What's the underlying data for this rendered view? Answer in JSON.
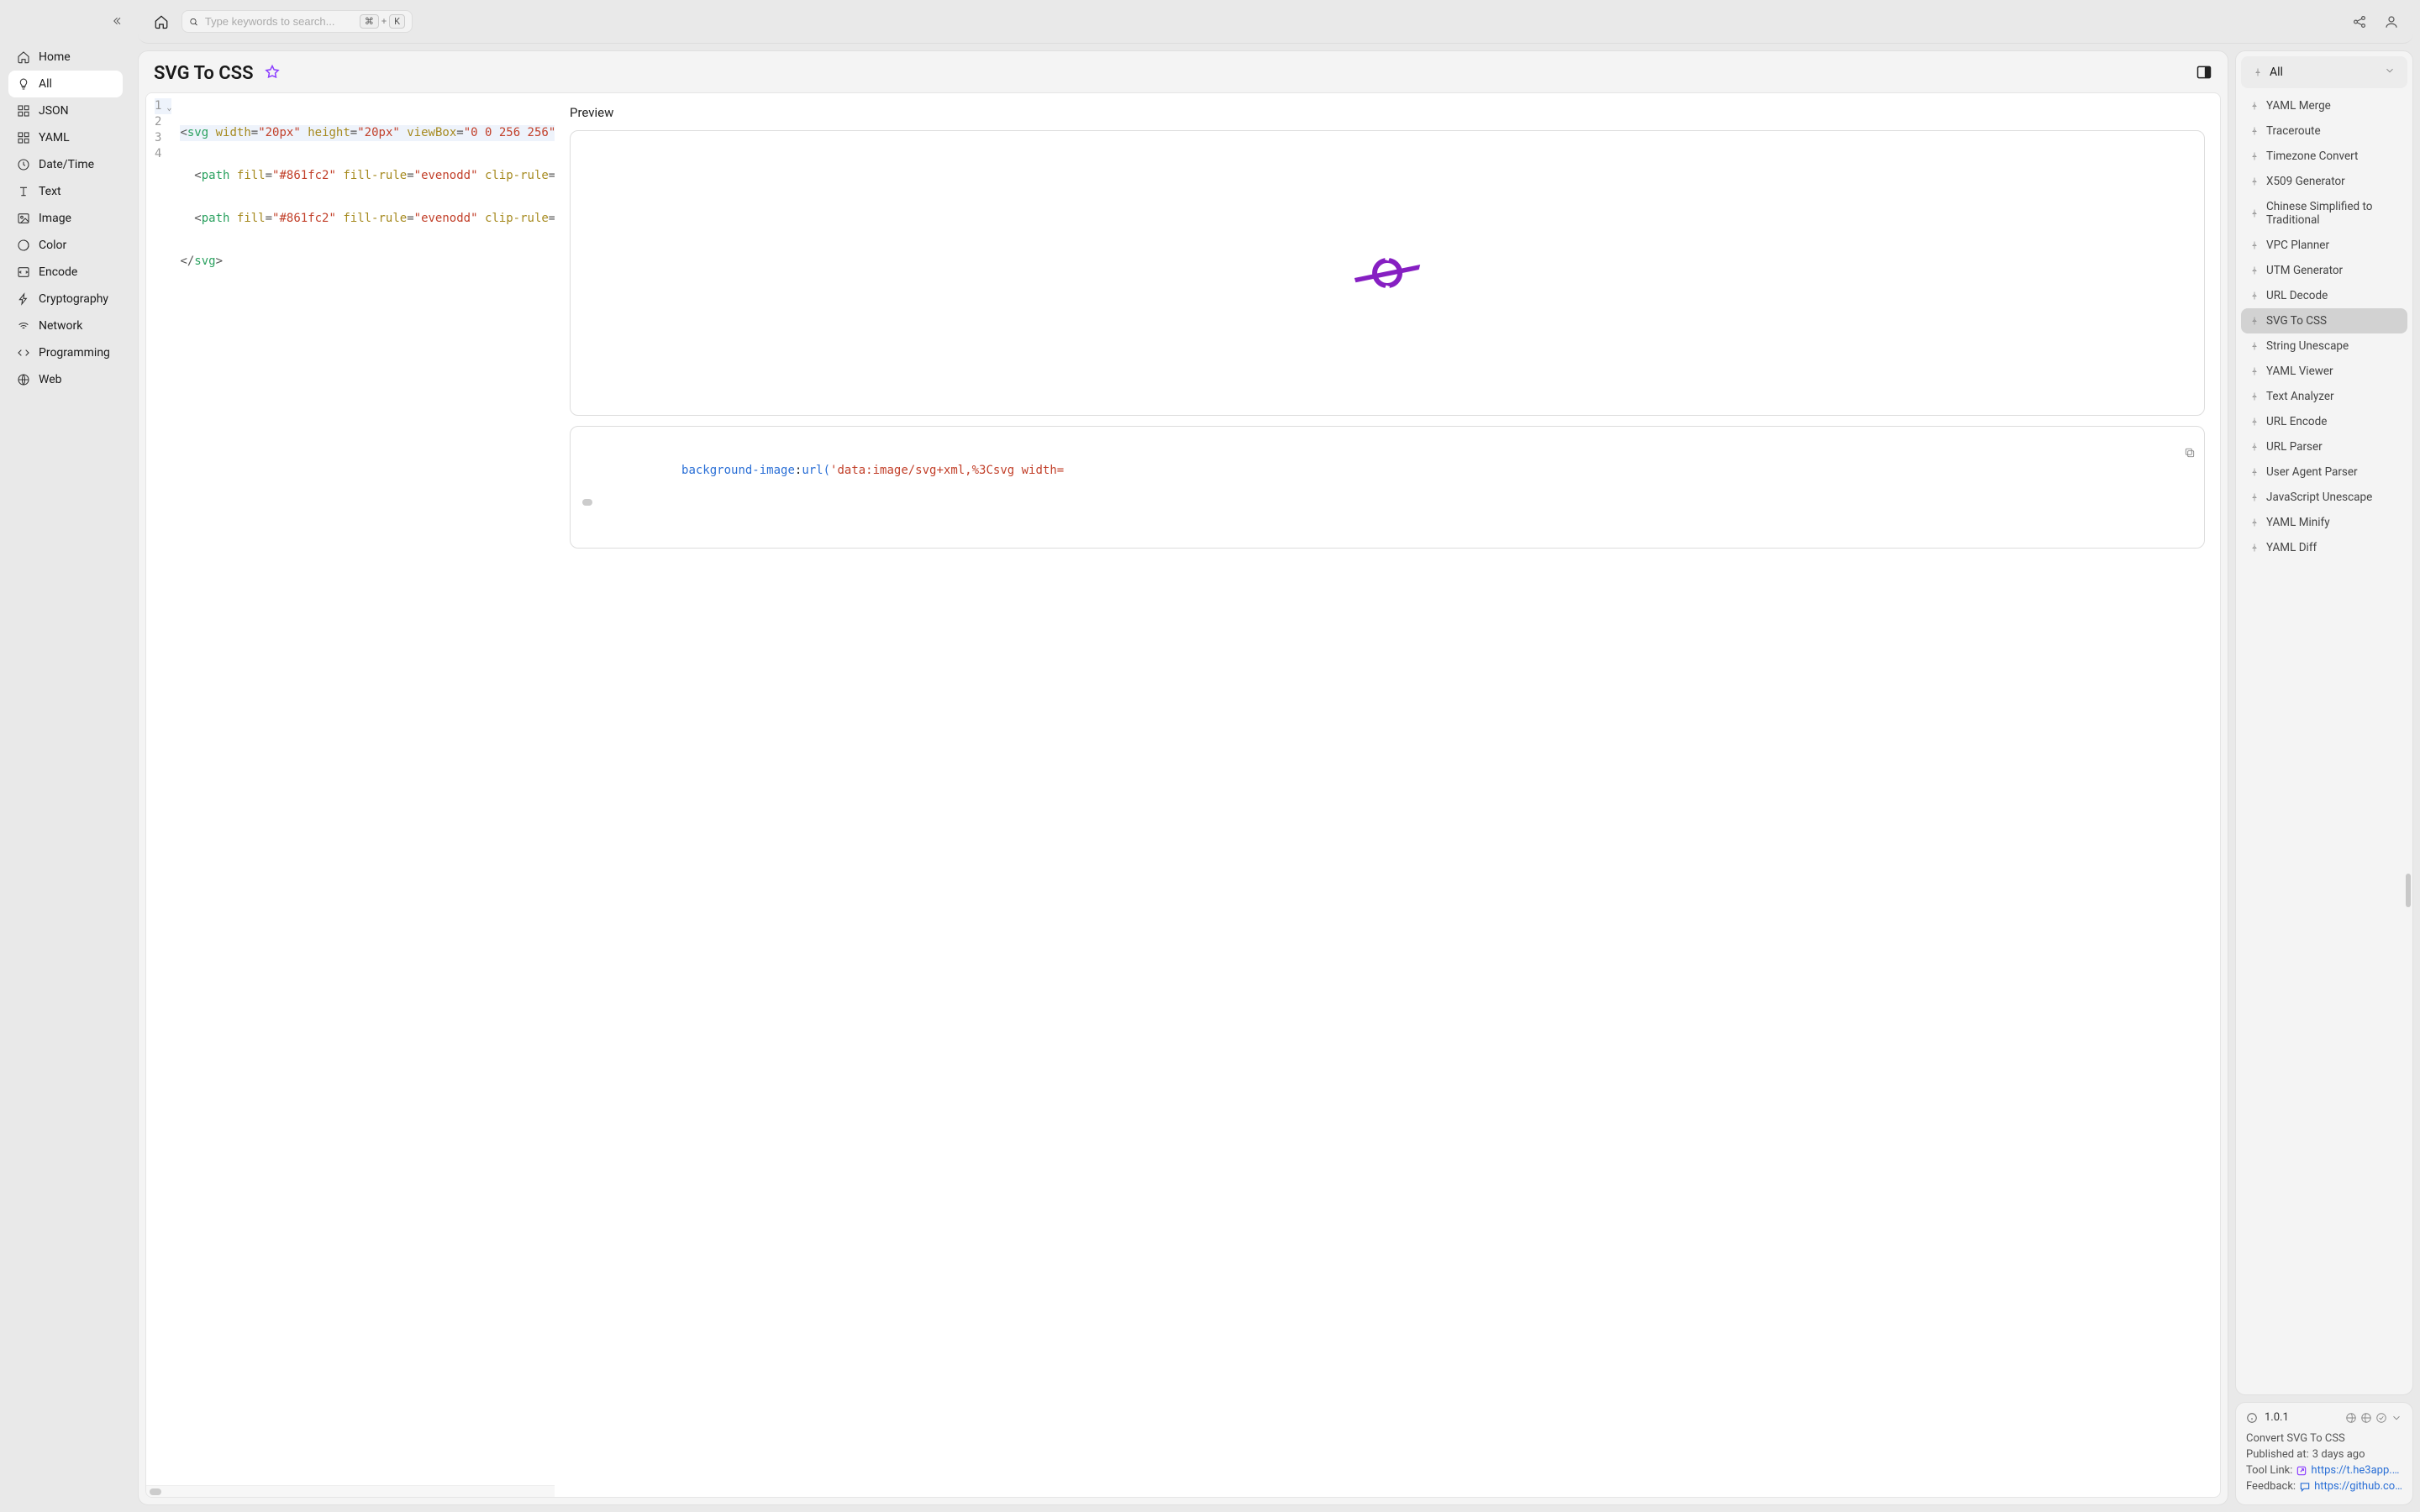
{
  "sidebar": {
    "items": [
      {
        "label": "Home",
        "icon": "home"
      },
      {
        "label": "All",
        "icon": "all",
        "active": true
      },
      {
        "label": "JSON",
        "icon": "json"
      },
      {
        "label": "YAML",
        "icon": "yaml"
      },
      {
        "label": "Date/Time",
        "icon": "clock"
      },
      {
        "label": "Text",
        "icon": "text"
      },
      {
        "label": "Image",
        "icon": "image"
      },
      {
        "label": "Color",
        "icon": "color"
      },
      {
        "label": "Encode",
        "icon": "encode"
      },
      {
        "label": "Cryptography",
        "icon": "crypto"
      },
      {
        "label": "Network",
        "icon": "network"
      },
      {
        "label": "Programming",
        "icon": "programming"
      },
      {
        "label": "Web",
        "icon": "web"
      }
    ]
  },
  "search": {
    "placeholder": "Type keywords to search...",
    "kbd1": "⌘",
    "kbd_plus": "+",
    "kbd2": "K"
  },
  "page": {
    "title": "SVG To CSS"
  },
  "editor": {
    "lines": {
      "l1": {
        "n": "1",
        "open": "<",
        "tag": "svg",
        "a1": "width",
        "v1": "\"20px\"",
        "a2": "height",
        "v2": "\"20px\"",
        "a3": "viewBox",
        "v3": "\"0 0 256 256\"",
        "tail": " "
      },
      "l2": {
        "n": "2",
        "open": "<",
        "tag": "path",
        "a1": "fill",
        "v1": "\"#861fc2\"",
        "a2": "fill-rule",
        "v2": "\"evenodd\"",
        "a3": "clip-rule",
        "v3": "\""
      },
      "l3": {
        "n": "3",
        "open": "<",
        "tag": "path",
        "a1": "fill",
        "v1": "\"#861fc2\"",
        "a2": "fill-rule",
        "v2": "\"evenodd\"",
        "a3": "clip-rule",
        "v3": "\""
      },
      "l4": {
        "n": "4",
        "open": "</",
        "tag": "svg",
        "close": ">"
      }
    }
  },
  "preview": {
    "label": "Preview"
  },
  "output": {
    "prop": "background-image",
    "colon": ":",
    "func": "url(",
    "q": "'",
    "val": "data:image/svg+xml,%3Csvg width="
  },
  "tools": {
    "filter_label": "All",
    "items": [
      "YAML Merge",
      "Traceroute",
      "Timezone Convert",
      "X509 Generator",
      "Chinese Simplified to Traditional",
      "VPC Planner",
      "UTM Generator",
      "URL Decode",
      "SVG To CSS",
      "String Unescape",
      "YAML Viewer",
      "Text Analyzer",
      "URL Encode",
      "URL Parser",
      "User Agent Parser",
      "JavaScript Unescape",
      "YAML Minify",
      "YAML Diff"
    ],
    "active_index": 8
  },
  "info": {
    "version": "1.0.1",
    "desc": "Convert SVG To CSS",
    "published_label": "Published at:",
    "published_value": "3 days ago",
    "toollink_label": "Tool Link:",
    "toollink_value": "https://t.he3app.co…",
    "feedback_label": "Feedback:",
    "feedback_value": "https://github.com/…"
  }
}
